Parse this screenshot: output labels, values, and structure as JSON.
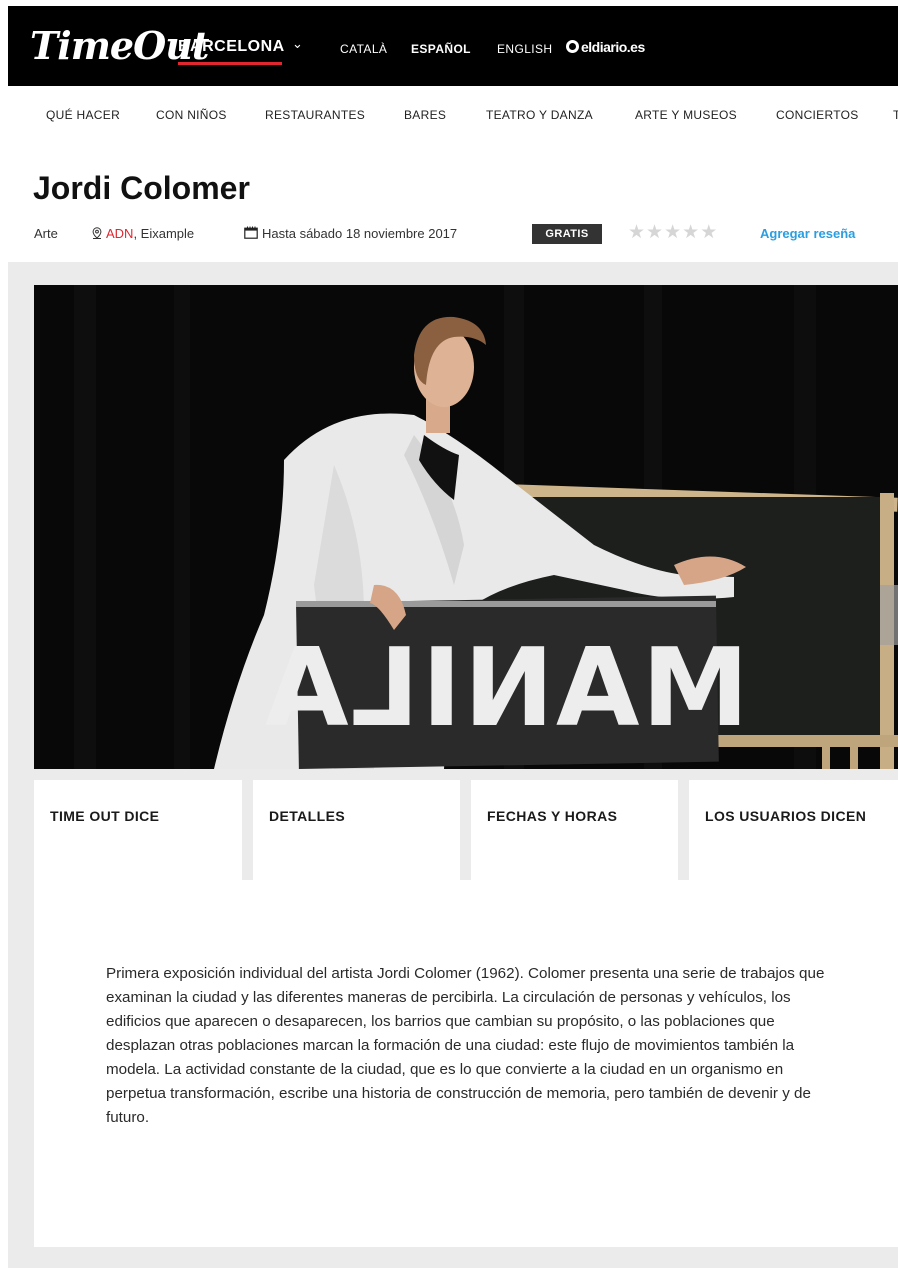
{
  "header": {
    "logo": "TimeOut",
    "city": "BARCELONA",
    "languages": [
      {
        "label": "CATALÀ",
        "active": false
      },
      {
        "label": "ESPAÑOL",
        "active": true
      },
      {
        "label": "ENGLISH",
        "active": false
      }
    ],
    "partner": "eldiario.es"
  },
  "nav": {
    "items": [
      "QUÉ HACER",
      "CON NIÑOS",
      "RESTAURANTES",
      "BARES",
      "TEATRO Y DANZA",
      "ARTE Y MUSEOS",
      "CONCIERTOS",
      "T"
    ]
  },
  "event": {
    "title": "Jordi Colomer",
    "category": "Arte",
    "venue": "ADN",
    "neighborhood": ", Eixample",
    "dates": "Hasta sábado 18 noviembre 2017",
    "price_badge": "GRATIS",
    "rating_stars": 5,
    "rating_value": 0,
    "review_link": "Agregar reseña"
  },
  "hero": {
    "sign_text": "MANILA"
  },
  "tabs": [
    {
      "label": "TIME OUT DICE",
      "active": true
    },
    {
      "label": "DETALLES",
      "active": false
    },
    {
      "label": "FECHAS Y HORAS",
      "active": false
    },
    {
      "label": "LOS USUARIOS DICEN",
      "active": false
    }
  ],
  "article": {
    "body": "Primera exposición individual del artista Jordi Colomer (1962). Colomer presenta una serie de trabajos que examinan la ciudad y las diferentes maneras de percibirla. La circulación de personas y vehículos, los edificios que aparecen o desaparecen, los barrios que cambian su propósito, o las poblaciones que desplazan otras poblaciones marcan la formación de una ciudad: este flujo de movimientos también la modela. La actividad constante de la ciudad, que es lo que convierte a la ciudad en un organismo en perpetua transformación, escribe una historia de construcción de memoria, pero también de devenir y de futuro."
  },
  "colors": {
    "accent_red": "#e0262f",
    "link_blue": "#2a9ee0",
    "badge_bg": "#333333"
  }
}
